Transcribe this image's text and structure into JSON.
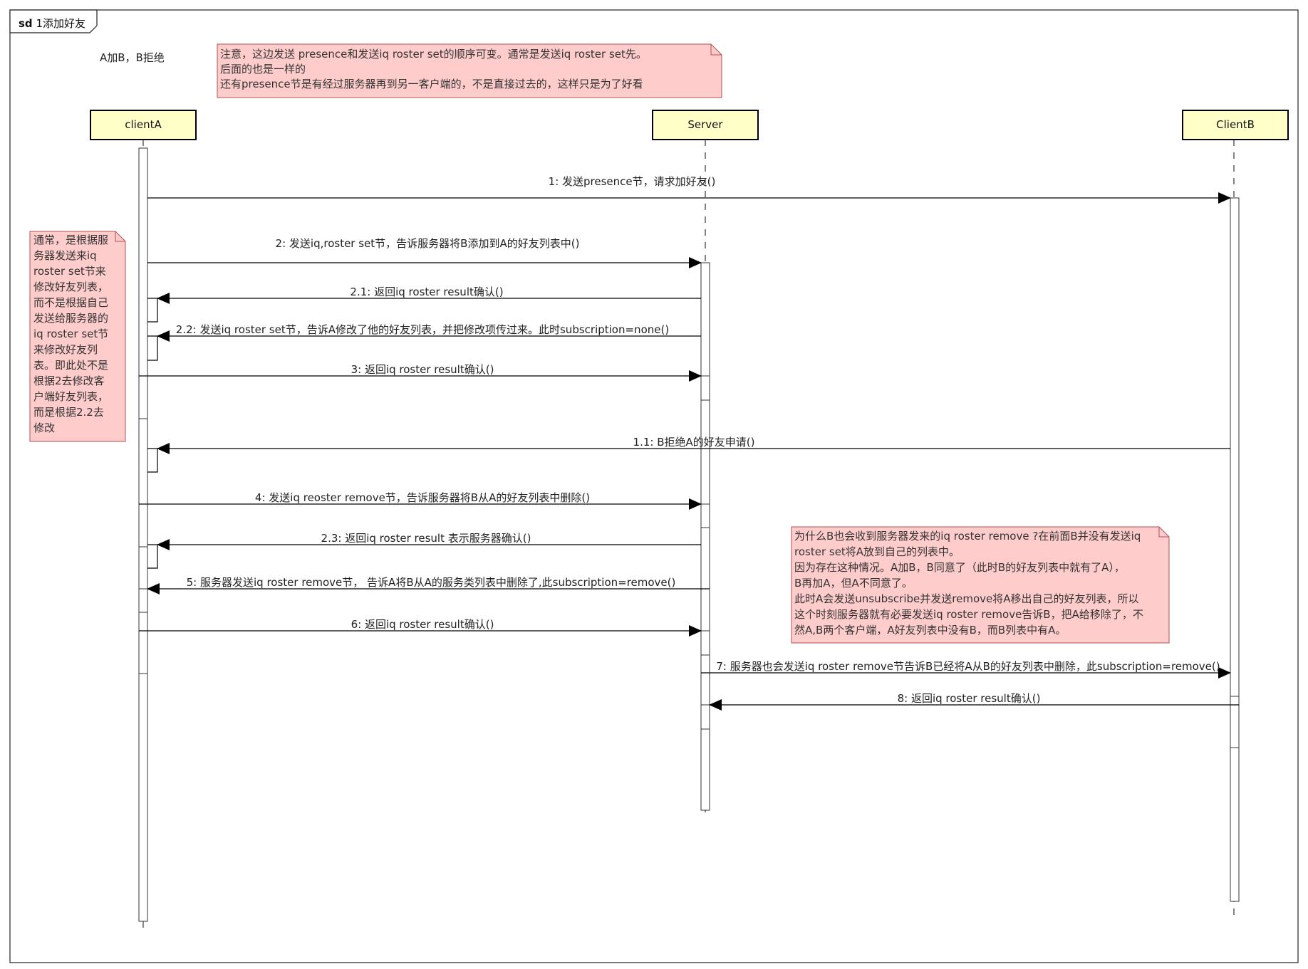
{
  "frame": {
    "keyword": "sd",
    "title": "1添加好友"
  },
  "subtitle": "A加B，B拒绝",
  "colors": {
    "lifeline_box": "#ffffc8",
    "note_fill": "#ffcccc",
    "note_border": "#b05050",
    "line": "#000000"
  },
  "participants": [
    {
      "id": "clientA",
      "label": "clientA"
    },
    {
      "id": "server",
      "label": "Server"
    },
    {
      "id": "clientB",
      "label": "ClientB"
    }
  ],
  "notes": {
    "top": [
      "注意，这边发送 presence和发送iq roster set的顺序可变。通常是发送iq roster set先。",
      "后面的也是一样的",
      "还有presence节是有经过服务器再到另一客户端的，不是直接过去的，这样只是为了好看"
    ],
    "left": [
      "通常，是根据服",
      "务器发送来iq",
      "roster set节来",
      "修改好友列表，",
      "而不是根据自己",
      "发送给服务器的",
      "iq roster set节",
      "来修改好友列",
      "表。即此处不是",
      "根据2去修改客",
      "户端好友列表，",
      "而是根据2.2去",
      "修改"
    ],
    "right": [
      "为什么B也会收到服务器发来的iq roster  remove ?在前面B并没有发送iq",
      "roster set将A放到自己的列表中。",
      "因为存在这种情况。A加B，B同意了（此时B的好友列表中就有了A），",
      "B再加A，但A不同意了。",
      "此时A会发送unsubscribe并发送remove将A移出自己的好友列表，所以",
      "这个时刻服务器就有必要发送iq roster remove告诉B，把A给移除了，不",
      "然A,B两个客户端，A好友列表中没有B，而B列表中有A。"
    ]
  },
  "messages": [
    {
      "label": "1: 发送presence节，请求加好友()"
    },
    {
      "label": "2: 发送iq,roster set节，告诉服务器将B添加到A的好友列表中()"
    },
    {
      "label": "2.1: 返回iq roster result确认()"
    },
    {
      "label": "2.2: 发送iq roster set节，告诉A修改了他的好友列表，并把修改项传过来。此时subscription=none()"
    },
    {
      "label": "3: 返回iq roster result确认()"
    },
    {
      "label": "1.1: B拒绝A的好友申请()"
    },
    {
      "label": "4: 发送iq reoster remove节，告诉服务器将B从A的好友列表中删除()"
    },
    {
      "label": "2.3: 返回iq roster result  表示服务器确认()"
    },
    {
      "label": "5: 服务器发送iq roster remove节， 告诉A将B从A的服务类列表中删除了,此subscription=remove()"
    },
    {
      "label": "6: 返回iq roster result确认()"
    },
    {
      "label": "7: 服务器也会发送iq roster remove节告诉B已经将A从B的好友列表中删除，此subscription=remove()"
    },
    {
      "label": "8: 返回iq roster result确认()"
    }
  ]
}
